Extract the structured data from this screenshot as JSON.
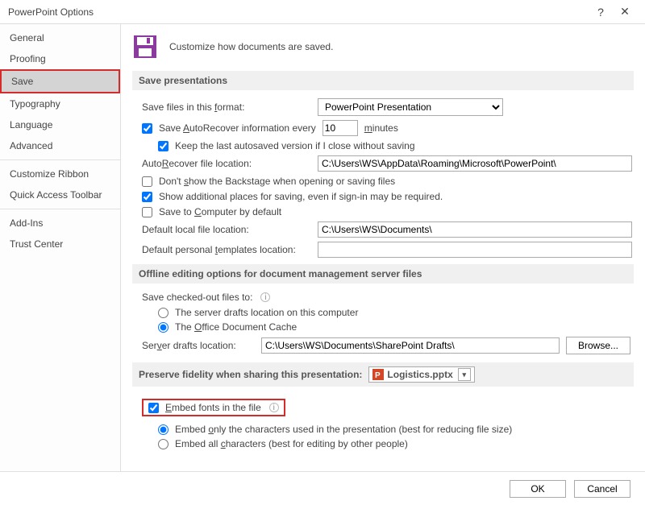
{
  "window": {
    "title": "PowerPoint Options"
  },
  "sidebar": {
    "items": [
      {
        "label": "General"
      },
      {
        "label": "Proofing"
      },
      {
        "label": "Save"
      },
      {
        "label": "Typography"
      },
      {
        "label": "Language"
      },
      {
        "label": "Advanced"
      },
      {
        "label": "Customize Ribbon"
      },
      {
        "label": "Quick Access Toolbar"
      },
      {
        "label": "Add-Ins"
      },
      {
        "label": "Trust Center"
      }
    ]
  },
  "header": {
    "text": "Customize how documents are saved."
  },
  "sections": {
    "save_presentations": "Save presentations",
    "offline": "Offline editing options for document management server files",
    "preserve": "Preserve fidelity when sharing this presentation:"
  },
  "save": {
    "format_label": "Save files in this format:",
    "format_value": "PowerPoint Presentation",
    "autorecover_label": "Save AutoRecover information every",
    "autorecover_value": "10",
    "autorecover_unit": "minutes",
    "keep_last_label": "Keep the last autosaved version if I close without saving",
    "autorecover_loc_label": "AutoRecover file location:",
    "autorecover_loc_value": "C:\\Users\\WS\\AppData\\Roaming\\Microsoft\\PowerPoint\\",
    "dont_show_backstage": "Don't show the Backstage when opening or saving files",
    "show_additional": "Show additional places for saving, even if sign-in may be required.",
    "save_computer": "Save to Computer by default",
    "default_local_label": "Default local file location:",
    "default_local_value": "C:\\Users\\WS\\Documents\\",
    "default_templates_label": "Default personal templates location:",
    "default_templates_value": ""
  },
  "offline": {
    "save_checked_out": "Save checked-out files to:",
    "radio_server": "The server drafts location on this computer",
    "radio_cache": "The Office Document Cache",
    "drafts_label": "Server drafts location:",
    "drafts_value": "C:\\Users\\WS\\Documents\\SharePoint Drafts\\",
    "browse": "Browse..."
  },
  "preserve": {
    "file_name": "Logistics.pptx",
    "embed_fonts": "Embed fonts in the file",
    "embed_only": "Embed only the characters used in the presentation (best for reducing file size)",
    "embed_all": "Embed all characters (best for editing by other people)"
  },
  "footer": {
    "ok": "OK",
    "cancel": "Cancel"
  }
}
